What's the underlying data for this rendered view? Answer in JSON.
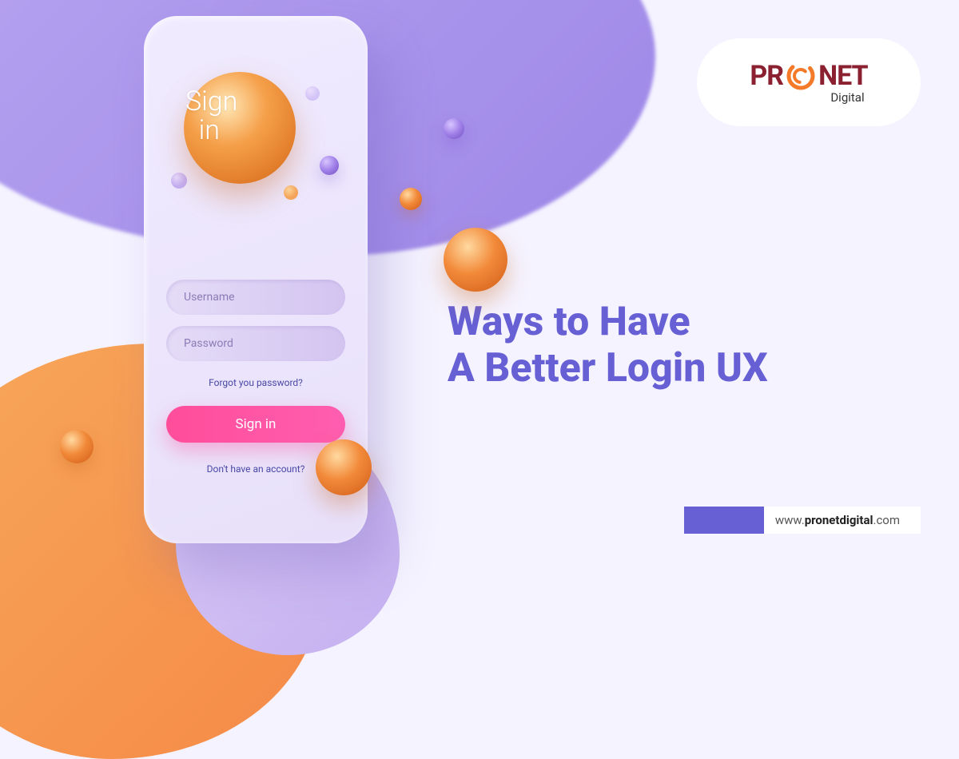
{
  "phone": {
    "signin_heading_line1": "Sign",
    "signin_heading_line2": "in",
    "username_placeholder": "Username",
    "password_placeholder": "Password",
    "forgot_link": "Forgot you password?",
    "signin_button": "Sign in",
    "no_account": "Don't have an account?"
  },
  "logo": {
    "pre": "PR",
    "post": "NET",
    "subtitle": "Digital"
  },
  "headline": {
    "line1": "Ways to Have",
    "line2": "A Better Login UX"
  },
  "footer": {
    "url_prefix": "www.",
    "url_bold": "pronetdigital",
    "url_suffix": ".com"
  },
  "colors": {
    "purple": "#6660d4",
    "orange": "#f28a3a",
    "pink": "#ff4d9a",
    "brand_maroon": "#8a2030"
  }
}
